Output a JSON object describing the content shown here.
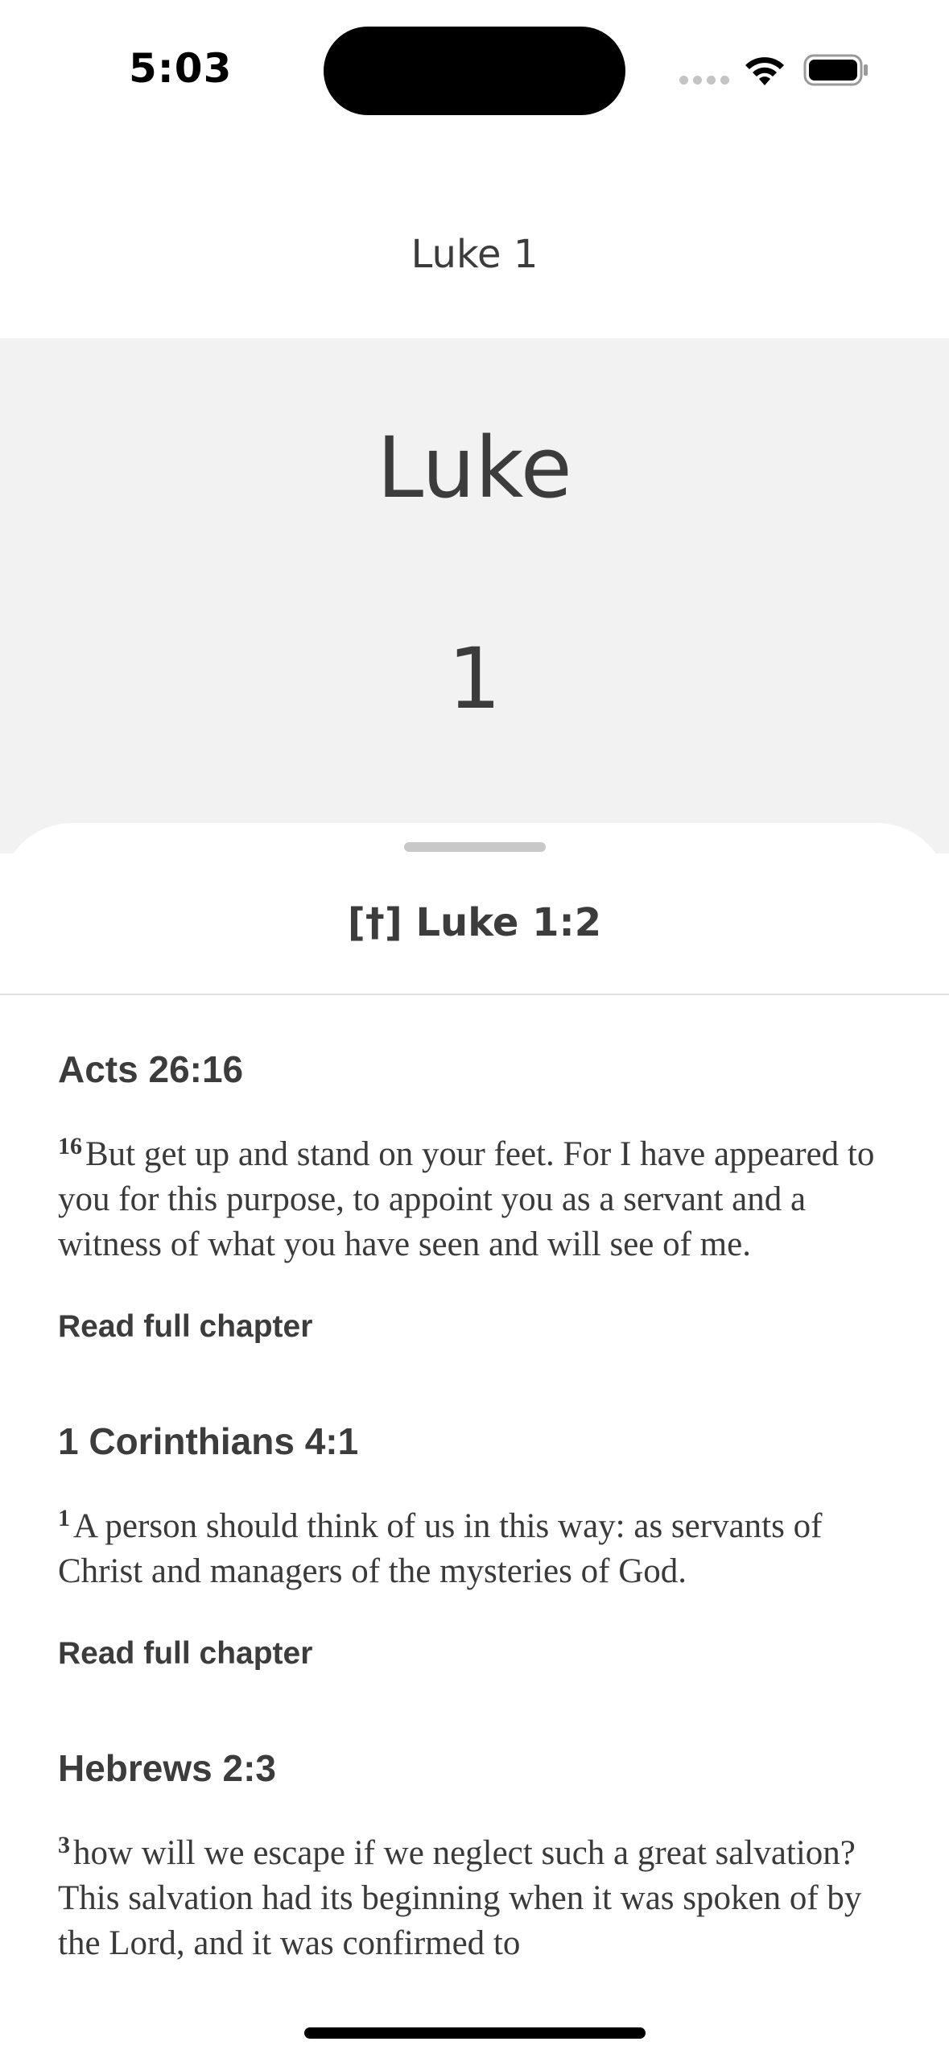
{
  "status_bar": {
    "time": "5:03",
    "icons": [
      "signal-icon",
      "wifi-icon",
      "battery-icon"
    ]
  },
  "nav": {
    "title": "Luke 1"
  },
  "chapter_header": {
    "book": "Luke",
    "chapter": "1"
  },
  "sheet": {
    "title": "[†] Luke 1:2",
    "references": [
      {
        "title": "Acts 26:16",
        "verse_number": "16",
        "text": "But get up and stand on your feet. For I have appeared to you for this purpose, to appoint you as a servant and a witness of what you have seen and will see of me.",
        "link_label": "Read full chapter"
      },
      {
        "title": "1 Corinthians 4:1",
        "verse_number": "1",
        "text": "A person should think of us in this way: as servants of Christ and managers of the mysteries of God.",
        "link_label": "Read full chapter"
      },
      {
        "title": "Hebrews 2:3",
        "verse_number": "3",
        "text": "how will we escape if we neglect such a great salvation? This salvation had its beginning when it was spoken of by the Lord, and it was confirmed to",
        "link_label": ""
      }
    ]
  },
  "colors": {
    "header_background": "#f2f2f2",
    "text": "#3c3c3c",
    "divider": "#e1e1e1",
    "handle": "#c8c8c8"
  }
}
